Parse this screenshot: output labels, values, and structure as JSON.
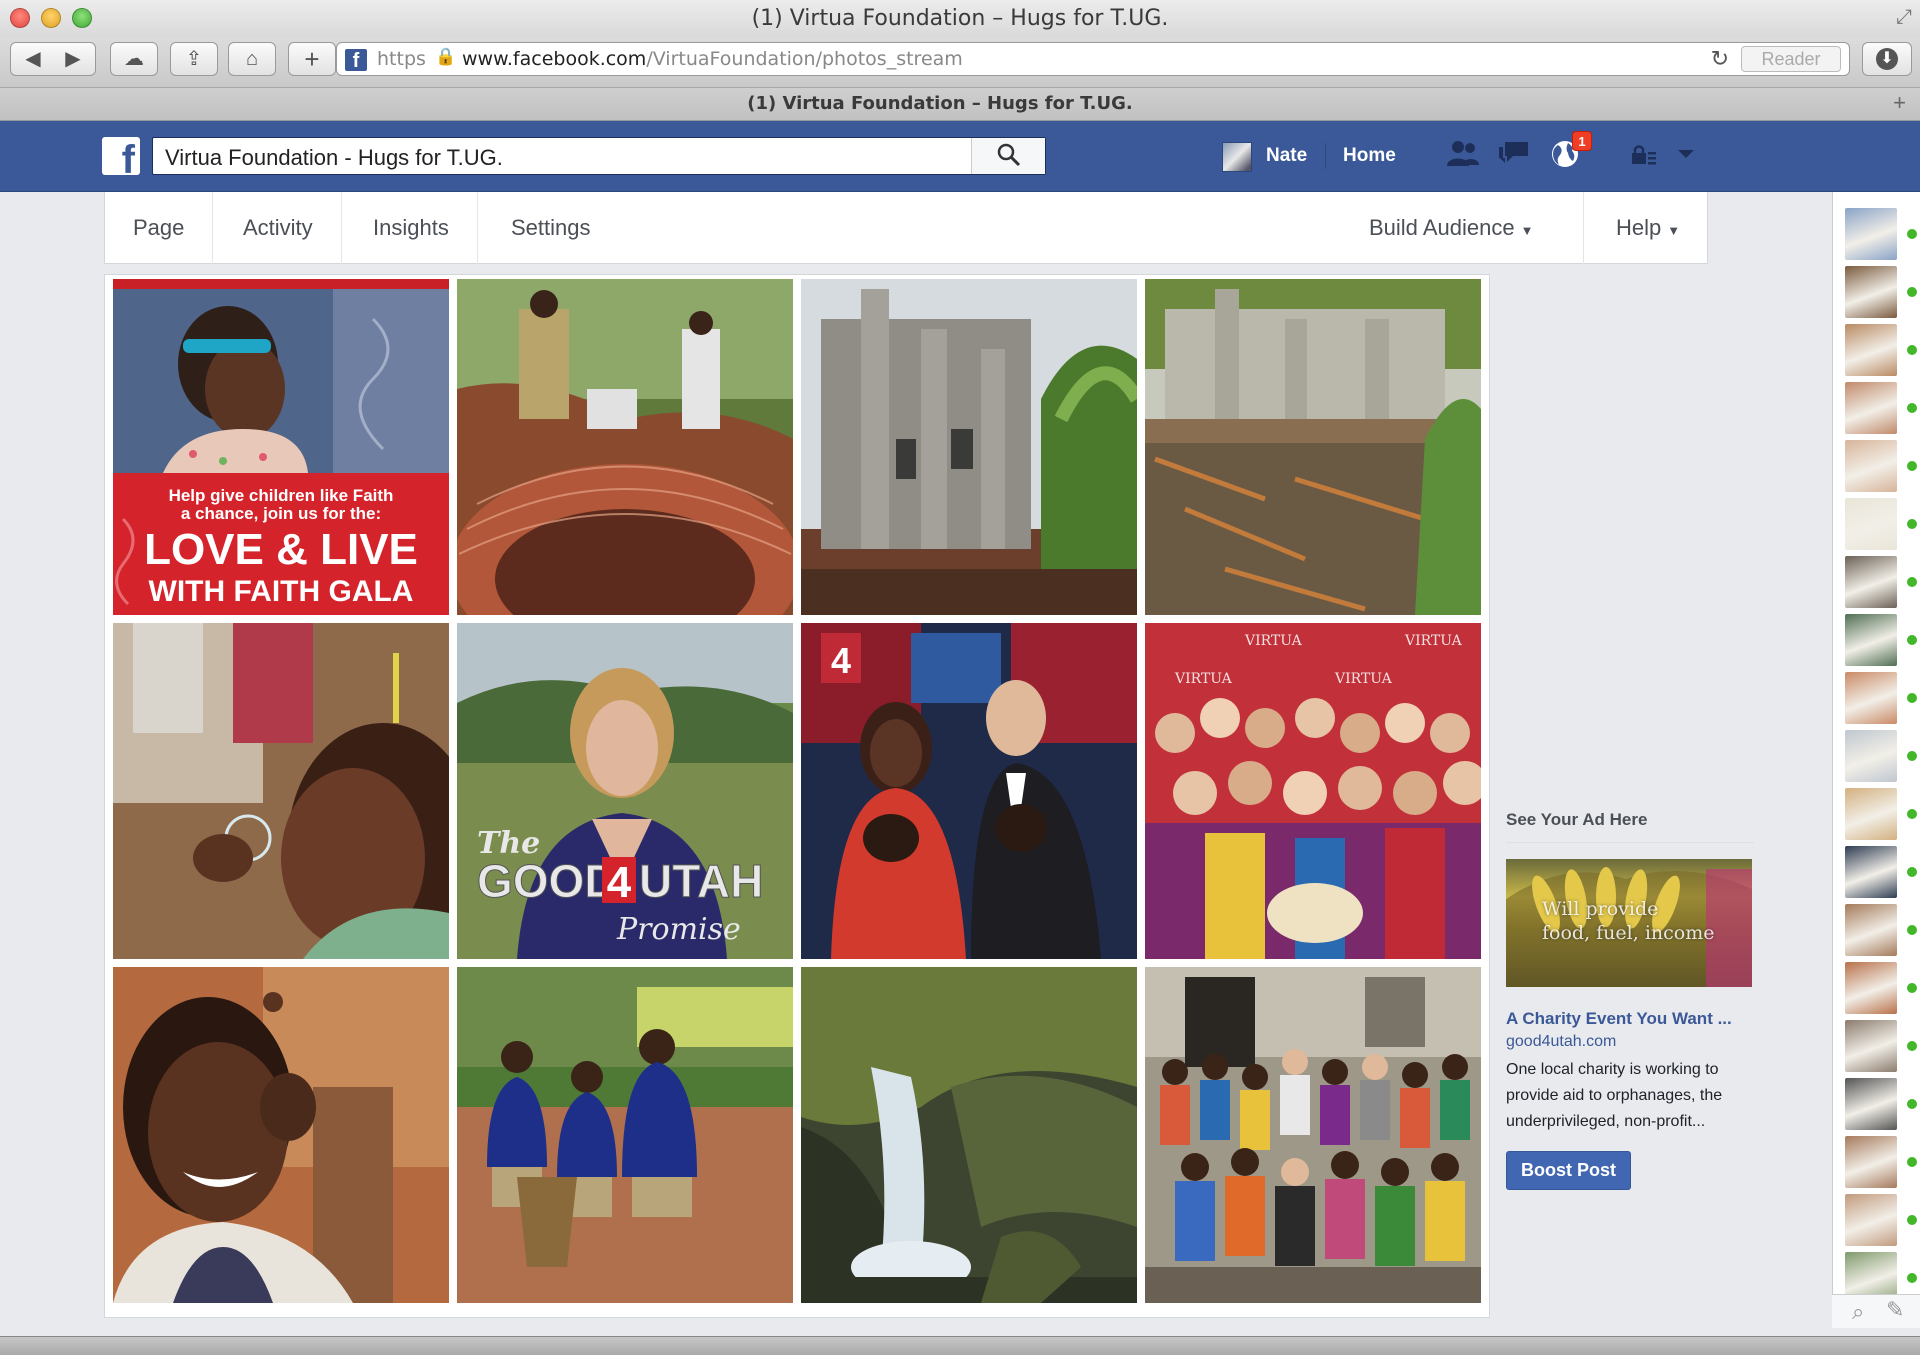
{
  "window": {
    "title": "(1) Virtua Foundation – Hugs for T.UG."
  },
  "toolbar": {
    "back_icon": "◀",
    "forward_icon": "▶",
    "cloud_icon": "☁",
    "share_icon": "⇪",
    "home_icon": "⌂",
    "new_tab_icon": "+",
    "url_scheme": "https",
    "url_host": "www.facebook.com",
    "url_path": "/VirtuaFoundation/photos_stream",
    "reload_icon": "↻",
    "reader_label": "Reader",
    "download_icon": "⬇"
  },
  "tab": {
    "title": "(1) Virtua Foundation – Hugs for T.UG.",
    "add_icon": "+"
  },
  "fb": {
    "logo": "f",
    "search_value": "Virtua Foundation - Hugs for T.UG.",
    "search_icon": "⌕",
    "user_name": "Nate",
    "home_label": "Home",
    "friends_icon": "👥",
    "messages_icon": "💬",
    "notifications_icon": "🌐",
    "notification_count": "1",
    "privacy_icon": "🔒",
    "settings_icon": "▼"
  },
  "admin_nav": {
    "tabs": [
      {
        "label": "Page"
      },
      {
        "label": "Activity"
      },
      {
        "label": "Insights"
      },
      {
        "label": "Settings"
      }
    ],
    "build_audience": "Build Audience",
    "help": "Help",
    "caret": "▼"
  },
  "photos": [
    {
      "name": "love-live-faith-gala-poster",
      "caption_lines": [
        "Help give children like Faith",
        "a chance, join us for the:"
      ],
      "headline": [
        "LOVE & LIVE",
        "WITH FAITH GALA"
      ]
    },
    {
      "name": "well-digging-photo"
    },
    {
      "name": "building-construction-photo"
    },
    {
      "name": "unfinished-building-photo"
    },
    {
      "name": "child-bubbles-photo"
    },
    {
      "name": "good4utah-promise-photo",
      "overlay_main": "GOOD",
      "overlay_num": "4",
      "overlay_end": "UTAH",
      "overlay_prefix": "The",
      "overlay_sub": "Promise"
    },
    {
      "name": "news-anchors-puppies-photo",
      "screen_text": "4"
    },
    {
      "name": "gala-group-photo",
      "backdrop_text": "VIRTUA"
    },
    {
      "name": "smiling-boy-photo"
    },
    {
      "name": "schoolchildren-bucket-photo"
    },
    {
      "name": "waterfall-photo"
    },
    {
      "name": "orphanage-group-photo"
    }
  ],
  "ad": {
    "header": "See Your Ad Here",
    "image_caption": [
      "Will provide",
      "food, fuel, income"
    ],
    "title": "A Charity Event You Want ...",
    "domain": "good4utah.com",
    "body": "One local charity is working to provide aid to orphanages, the underprivileged, non-profit...",
    "boost_label": "Boost Post"
  },
  "chat": {
    "search_icon": "⌕",
    "compose_icon": "✎",
    "friends": [
      {
        "color": "#8aa3c7"
      },
      {
        "color": "#7a5a3e"
      },
      {
        "color": "#b98a63"
      },
      {
        "color": "#c08a6a"
      },
      {
        "color": "#d7b49a"
      },
      {
        "color": "#e9e5d8"
      },
      {
        "color": "#6b6155"
      },
      {
        "color": "#4f6e52"
      },
      {
        "color": "#c98a66"
      },
      {
        "color": "#bfc7cf"
      },
      {
        "color": "#d3b07f"
      },
      {
        "color": "#2e3c52"
      },
      {
        "color": "#a47a59"
      },
      {
        "color": "#b8714a"
      },
      {
        "color": "#8b7b6d"
      },
      {
        "color": "#545454"
      },
      {
        "color": "#a67a5c"
      },
      {
        "color": "#c19a7d"
      },
      {
        "color": "#7f9a6b"
      }
    ]
  }
}
